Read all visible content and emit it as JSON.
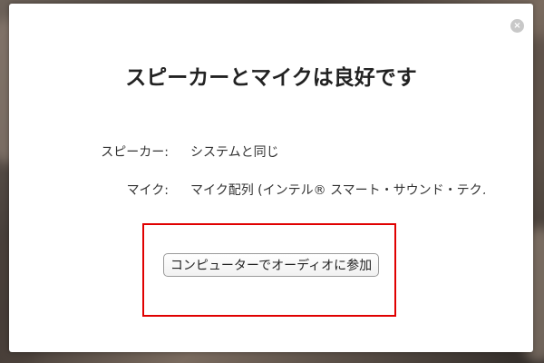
{
  "dialog": {
    "title": "スピーカーとマイクは良好です",
    "close_icon": "×",
    "speaker": {
      "label": "スピーカー:",
      "value": "システムと同じ"
    },
    "microphone": {
      "label": "マイク:",
      "value": "マイク配列 (インテル® スマート・サウンド・テクノロジ"
    },
    "join_button_label": "コンピューターでオーディオに参加"
  },
  "colors": {
    "highlight": "#e00000",
    "dialog_background": "#ffffff"
  }
}
